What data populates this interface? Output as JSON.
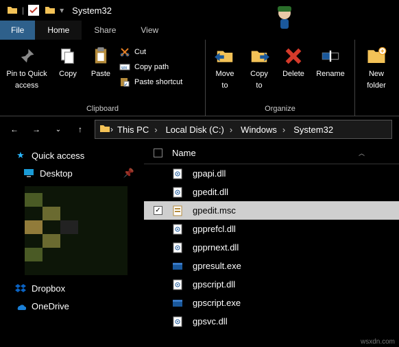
{
  "titlebar": {
    "title": "System32",
    "sep": "|",
    "dropdown": "▾"
  },
  "tabs": {
    "file": "File",
    "home": "Home",
    "share": "Share",
    "view": "View"
  },
  "ribbon": {
    "clipboard": {
      "title": "Clipboard",
      "pin_l1": "Pin to Quick",
      "pin_l2": "access",
      "copy": "Copy",
      "paste": "Paste",
      "cut": "Cut",
      "copypath": "Copy path",
      "pasteshortcut": "Paste shortcut"
    },
    "organize": {
      "title": "Organize",
      "move_l1": "Move",
      "move_l2": "to",
      "copy_l1": "Copy",
      "copy_l2": "to",
      "delete": "Delete",
      "rename": "Rename"
    },
    "new": {
      "folder_l1": "New",
      "folder_l2": "folder"
    }
  },
  "breadcrumbs": [
    "This PC",
    "Local Disk (C:)",
    "Windows",
    "System32"
  ],
  "nav": {
    "quick": "Quick access",
    "desktop": "Desktop",
    "dropbox": "Dropbox",
    "onedrive": "OneDrive"
  },
  "columns": {
    "name": "Name"
  },
  "files": [
    {
      "name": "gpapi.dll",
      "icon": "dll",
      "selected": false
    },
    {
      "name": "gpedit.dll",
      "icon": "dll",
      "selected": false
    },
    {
      "name": "gpedit.msc",
      "icon": "msc",
      "selected": true
    },
    {
      "name": "gpprefcl.dll",
      "icon": "dll",
      "selected": false
    },
    {
      "name": "gpprnext.dll",
      "icon": "dll",
      "selected": false
    },
    {
      "name": "gpresult.exe",
      "icon": "exe",
      "selected": false
    },
    {
      "name": "gpscript.dll",
      "icon": "dll",
      "selected": false
    },
    {
      "name": "gpscript.exe",
      "icon": "exe",
      "selected": false
    },
    {
      "name": "gpsvc.dll",
      "icon": "dll",
      "selected": false
    }
  ],
  "watermark": "wsxdn.com",
  "glyph": {
    "check": "✓",
    "chev": "›",
    "chevdown": "⌄",
    "back": "←",
    "fwd": "→",
    "up": "↑",
    "star": "★",
    "pin": "📌"
  }
}
